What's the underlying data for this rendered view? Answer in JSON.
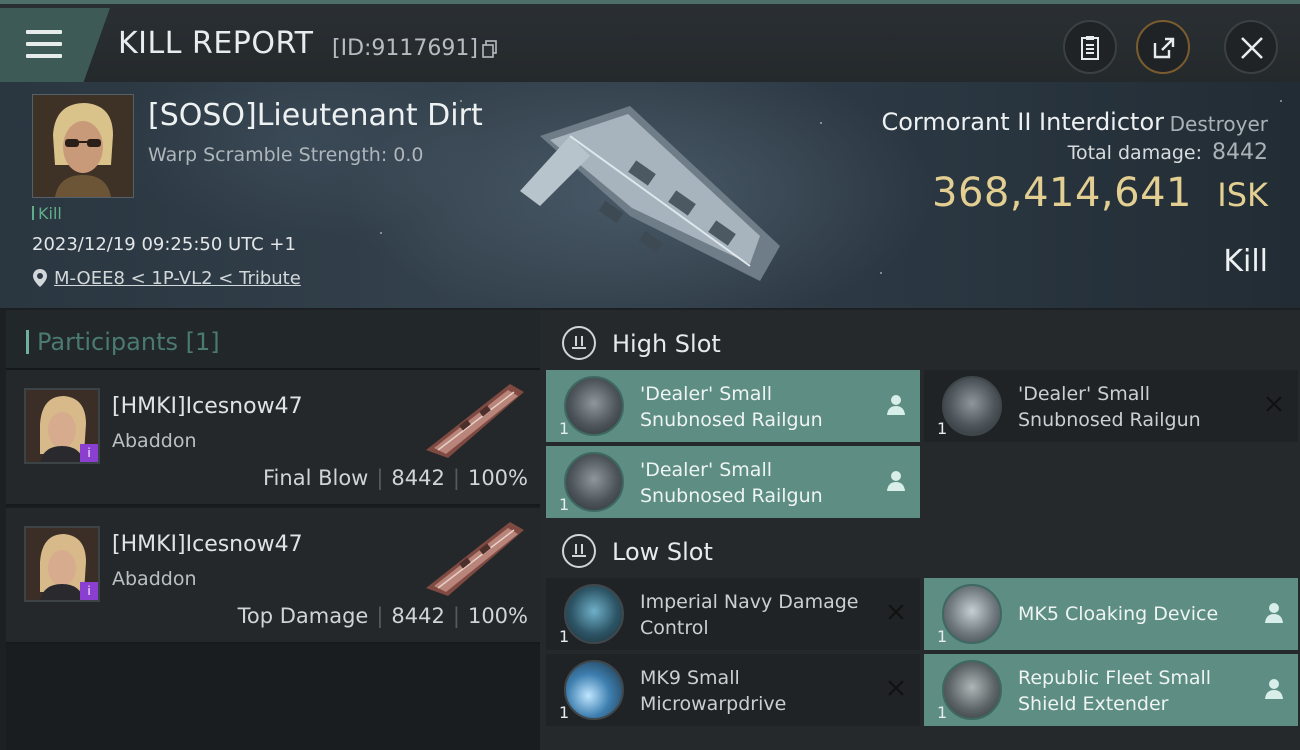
{
  "header": {
    "title": "KILL REPORT",
    "report_id": "[ID:9117691]"
  },
  "victim": {
    "name": "[SOSO]Lieutenant Dirt",
    "warp_scramble": "Warp Scramble Strength: 0.0",
    "kill_tag": "Kill",
    "timestamp": "2023/12/19 09:25:50 UTC +1",
    "location": "M-OEE8 < 1P-VL2 < Tribute"
  },
  "ship": {
    "name": "Cormorant II Interdictor",
    "class": "Destroyer",
    "total_damage_label": "Total damage:",
    "total_damage": "8442",
    "isk_value": "368,414,641",
    "isk_unit": "ISK",
    "result": "Kill"
  },
  "participants": {
    "title": "Participants",
    "count": "[1]",
    "rows": [
      {
        "name": "[HMKI]Icesnow47",
        "ship": "Abaddon",
        "role": "Final Blow",
        "damage": "8442",
        "percent": "100%"
      },
      {
        "name": "[HMKI]Icesnow47",
        "ship": "Abaddon",
        "role": "Top Damage",
        "damage": "8442",
        "percent": "100%"
      }
    ]
  },
  "fitting": {
    "high_slot_title": "High Slot",
    "low_slot_title": "Low Slot",
    "high_slot": [
      {
        "name": "'Dealer' Small Snubnosed Railgun",
        "qty": "1",
        "status": "dropped"
      },
      {
        "name": "'Dealer' Small Snubnosed Railgun",
        "qty": "1",
        "status": "destroyed"
      },
      {
        "name": "'Dealer' Small Snubnosed Railgun",
        "qty": "1",
        "status": "dropped"
      }
    ],
    "low_slot": [
      {
        "name": "Imperial Navy Damage Control",
        "qty": "1",
        "status": "destroyed"
      },
      {
        "name": "MK5 Cloaking Device",
        "qty": "1",
        "status": "dropped"
      },
      {
        "name": "MK9 Small Microwarpdrive",
        "qty": "1",
        "status": "destroyed"
      },
      {
        "name": "Republic Fleet Small Shield Extender",
        "qty": "1",
        "status": "dropped"
      }
    ]
  },
  "colors": {
    "accent_teal": "#5d8d83",
    "isk_gold": "#e3cf92",
    "kill_green": "#5fae8a",
    "badge_purple": "#8a3fd0"
  },
  "icons": [
    "menu-icon",
    "copy-icon",
    "clipboard-icon",
    "share-icon",
    "close-icon",
    "location-pin-icon",
    "high-slot-icon",
    "low-slot-icon",
    "person-icon",
    "x-mark-icon"
  ]
}
